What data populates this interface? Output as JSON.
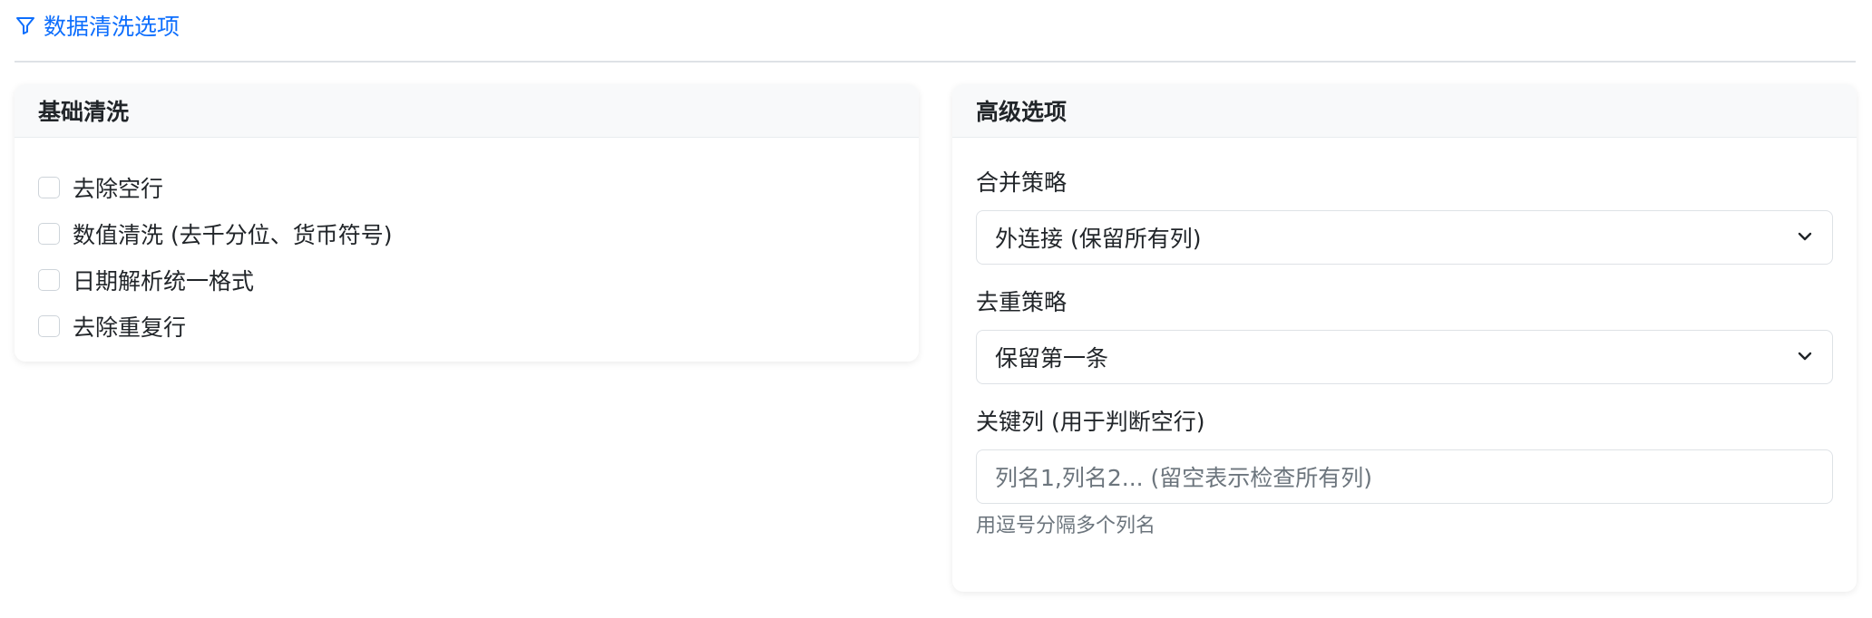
{
  "section": {
    "icon": "filter-icon",
    "title": "数据清洗选项",
    "accent_color": "#0d6efd"
  },
  "basic": {
    "title": "基础清洗",
    "options": [
      {
        "label": "去除空行",
        "checked": false
      },
      {
        "label": "数值清洗 (去千分位、货币符号)",
        "checked": false
      },
      {
        "label": "日期解析统一格式",
        "checked": false
      },
      {
        "label": "去除重复行",
        "checked": false
      }
    ]
  },
  "advanced": {
    "title": "高级选项",
    "merge_strategy": {
      "label": "合并策略",
      "value": "外连接 (保留所有列)"
    },
    "dedup_strategy": {
      "label": "去重策略",
      "value": "保留第一条"
    },
    "key_columns": {
      "label": "关键列 (用于判断空行)",
      "value": "",
      "placeholder": "列名1,列名2... (留空表示检查所有列)",
      "help": "用逗号分隔多个列名"
    }
  }
}
